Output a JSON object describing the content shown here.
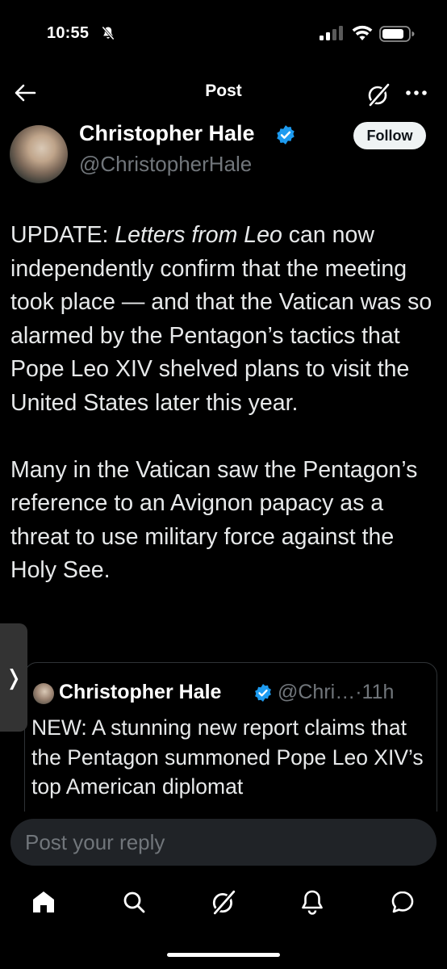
{
  "status_bar": {
    "time": "10:55",
    "icons": [
      "bell-slash-icon",
      "signal-icon",
      "wifi-icon",
      "battery-icon"
    ]
  },
  "nav": {
    "title": "Post",
    "back_icon": "arrow-left-icon",
    "grok_icon": "grok-icon",
    "more_icon": "more-horizontal-icon"
  },
  "author": {
    "name": "Christopher Hale",
    "handle": "@ChristopherHale",
    "verified": true,
    "follow_label": "Follow"
  },
  "post": {
    "p1_prefix": "UPDATE: ",
    "p1_italic": "Letters from Leo",
    "p1_rest": " can now independently confirm that the meeting took place — and that the Vatican was so alarmed by the Pentagon’s tactics that Pope Leo XIV shelved plans to visit the United States later this year.",
    "p2": "Many in the Vatican saw the Pentagon’s reference to an Avignon papacy as a threat to use military force against the Holy See."
  },
  "quote": {
    "name": "Christopher Hale",
    "handle": "@Chri…",
    "separator": "·",
    "time": "11h",
    "text": "NEW: A stunning new report claims that the Pentagon summoned Pope Leo XIV’s top American diplomat"
  },
  "side_tab": {
    "glyph": "❭"
  },
  "reply": {
    "placeholder": "Post your reply"
  },
  "tab_bar": {
    "items": [
      "home-icon",
      "search-icon",
      "grok-icon",
      "notifications-icon",
      "messages-icon"
    ]
  },
  "colors": {
    "background": "#000000",
    "text": "#e7e9ea",
    "muted": "#71767b",
    "verified": "#1d9bf0",
    "border": "#2f3336",
    "input_bg": "#202327"
  }
}
